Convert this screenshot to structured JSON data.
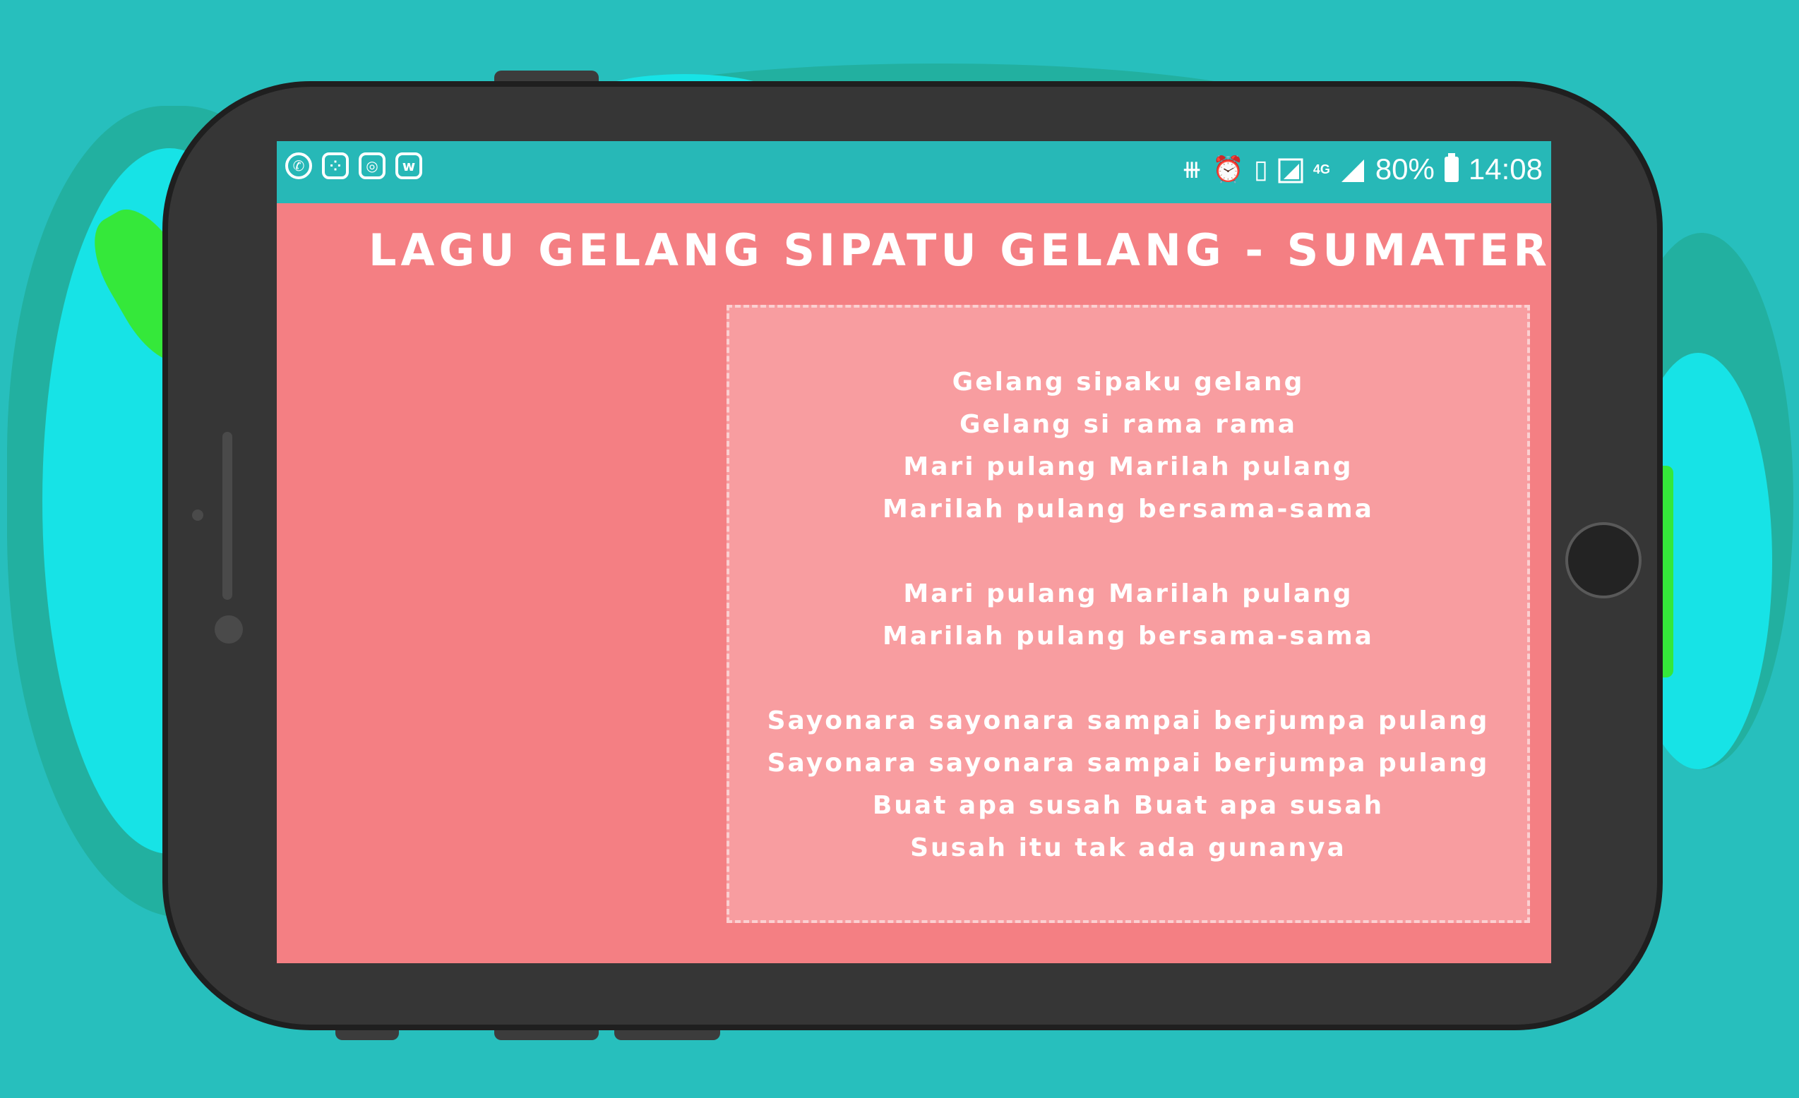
{
  "status_bar": {
    "notification_icons": [
      "whatsapp-icon",
      "bbm-icon",
      "instagram-icon",
      "wattpad-icon"
    ],
    "system_icons": [
      "vibrate-icon",
      "alarm-icon",
      "sim-icon",
      "wifi-signal-icon",
      "4g-icon",
      "cell-signal-icon",
      "battery-icon"
    ],
    "network": "4G",
    "battery": "80%",
    "time": "14:08"
  },
  "page": {
    "title": "LAGU GELANG SIPATU GELANG - SUMATERA"
  },
  "lyrics": [
    "Gelang sipaku gelang",
    "Gelang si rama rama",
    "Mari pulang Marilah pulang",
    "Marilah pulang bersama-sama",
    "",
    "Mari pulang Marilah pulang",
    "Marilah pulang bersama-sama",
    "",
    "Sayonara sayonara sampai berjumpa pulang",
    "Sayonara sayonara sampai berjumpa pulang",
    "Buat apa susah Buat apa susah",
    "Susah itu tak ada gunanya"
  ],
  "colors": {
    "background": "#27bfbd",
    "status_bar": "#27b8b7",
    "screen": "#f47f83",
    "lyrics_box": "#f89da0"
  }
}
